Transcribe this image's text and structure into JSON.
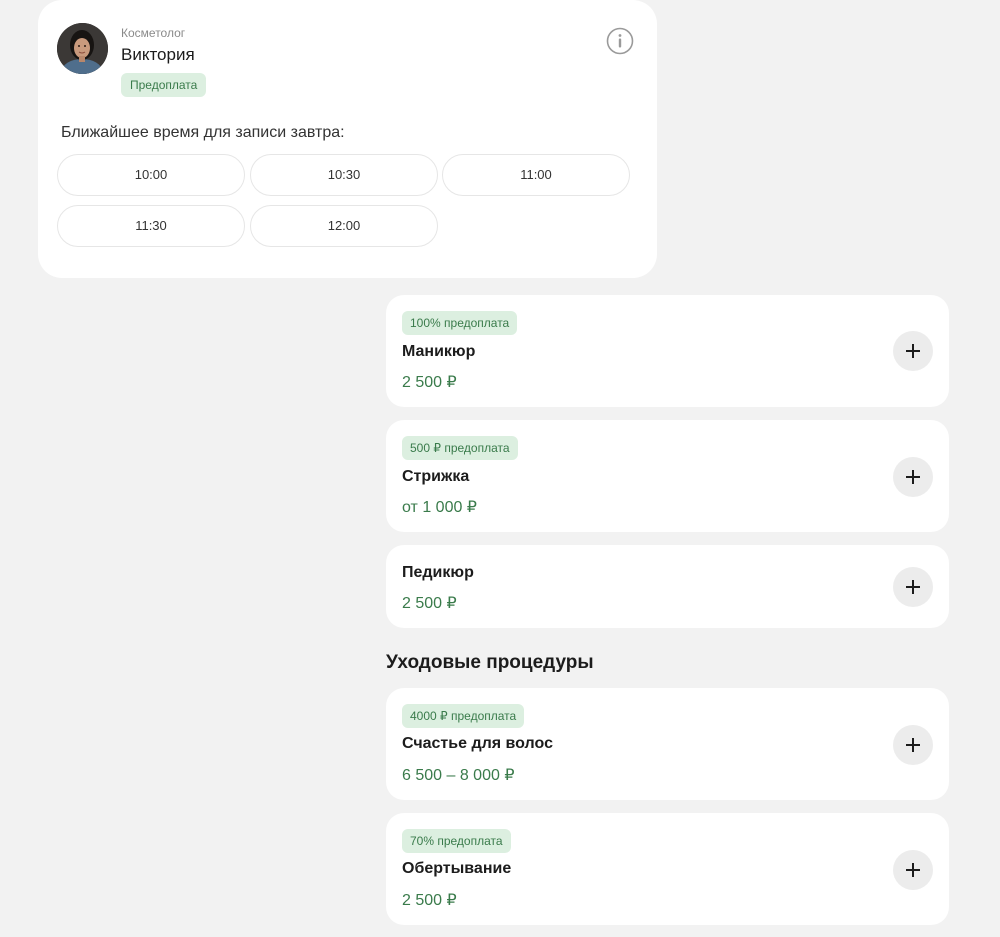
{
  "specialist": {
    "role": "Косметолог",
    "name": "Виктория",
    "badge": "Предоплата",
    "info_icon": "info-icon",
    "avatar_icon": "avatar-photo"
  },
  "slots": {
    "title": "Ближайшее время для записи завтра:",
    "times": [
      "10:00",
      "10:30",
      "11:00",
      "11:30",
      "12:00"
    ]
  },
  "services": [
    {
      "badge": "100% предоплата",
      "name": "Маникюр",
      "price": "2 500 ₽"
    },
    {
      "badge": "500 ₽ предоплата",
      "name": "Стрижка",
      "price": "от 1 000 ₽"
    },
    {
      "badge": "",
      "name": "Педикюр",
      "price": "2 500 ₽"
    }
  ],
  "care_section": {
    "title": "Уходовые процедуры",
    "services": [
      {
        "badge": "4000 ₽ предоплата",
        "name": "Счастье для волос",
        "price": "6 500 – 8 000 ₽"
      },
      {
        "badge": "70% предоплата",
        "name": "Обертывание",
        "price": "2 500 ₽"
      }
    ]
  },
  "colors": {
    "background": "#f2f2f2",
    "accent_green": "#3a7b4b",
    "badge_bg": "#dcefe0"
  },
  "add_icon": "plus-icon"
}
